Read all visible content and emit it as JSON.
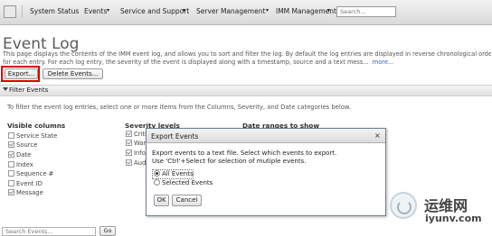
{
  "nav": {
    "items": [
      "System Status",
      "Events",
      "Service and Support",
      "Server Management",
      "IMM Management"
    ],
    "search_placeholder": "Search..."
  },
  "page": {
    "title": "Event Log",
    "desc_line1": "This page displays the contents of the IMM event log, and allows you to sort and filter the log. By default the log entries are displayed in reverse chronological order",
    "desc_line2": "for each entry. For each log entry, the severity of the event is displayed along with a timestamp, source and a text mess...",
    "more_link": "more..."
  },
  "toolbar": {
    "export_label": "Export...",
    "delete_label": "Delete Events..."
  },
  "filter": {
    "toggle_label": "Filter Events",
    "instructions": "To filter the event log entries, select one or more items from the Columns, Severity, and Date categories below.",
    "visible_columns_head": "Visible columns",
    "severity_head": "Severity levels",
    "date_head": "Date ranges to show",
    "columns": [
      {
        "label": "Service State",
        "checked": false
      },
      {
        "label": "Source",
        "checked": true
      },
      {
        "label": "Date",
        "checked": true
      },
      {
        "label": "Index",
        "checked": false
      },
      {
        "label": "Sequence #",
        "checked": false
      },
      {
        "label": "Event ID",
        "checked": false
      },
      {
        "label": "Message",
        "checked": true
      }
    ],
    "severities": [
      {
        "label": "Criti",
        "checked": true
      },
      {
        "label": "Warn",
        "checked": true
      },
      {
        "label": "Info",
        "checked": true
      },
      {
        "label": "Audi",
        "checked": true
      }
    ]
  },
  "dialog": {
    "title": "Export Events",
    "close_glyph": "×",
    "message_line1": "Export events to a text file. Select which events to export.",
    "message_line2": "Use 'Ctrl'+Select for selection of mutiple events.",
    "option_all": "All Events",
    "option_selected": "Selected Events",
    "ok_label": "OK",
    "cancel_label": "Cancel"
  },
  "bottom": {
    "search_placeholder": "Search Events...",
    "go_label": "Go"
  },
  "watermark": {
    "cn_text": "运维网",
    "url_text": "iyunv.com"
  },
  "colors": {
    "highlight": "#e00000",
    "link": "#3366cc"
  }
}
